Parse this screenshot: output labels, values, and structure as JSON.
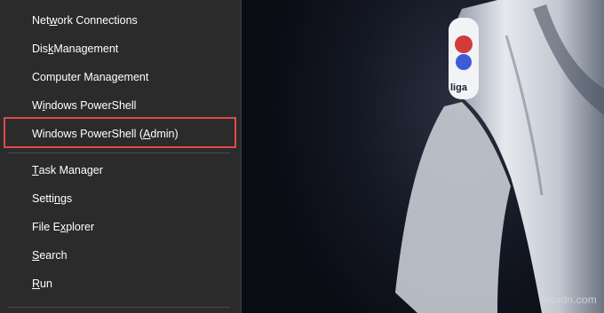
{
  "menu": {
    "items": [
      {
        "pre": "Net",
        "u": "w",
        "post": "ork Connections"
      },
      {
        "pre": "Dis",
        "u": "k",
        "post": " Management"
      },
      {
        "pre": "Computer Mana",
        "u": "g",
        "post": "ement"
      },
      {
        "pre": "W",
        "u": "i",
        "post": "ndows PowerShell"
      },
      {
        "pre": "Windows PowerShell (",
        "u": "A",
        "post": "dmin)"
      },
      {
        "pre": "",
        "u": "T",
        "post": "ask Manager"
      },
      {
        "pre": "Setti",
        "u": "n",
        "post": "gs"
      },
      {
        "pre": "File E",
        "u": "x",
        "post": "plorer"
      },
      {
        "pre": "",
        "u": "S",
        "post": "earch"
      },
      {
        "pre": "",
        "u": "R",
        "post": "un"
      }
    ],
    "highlighted_item": "Windows PowerShell (Admin)",
    "highlight_color": "#e24a4a"
  },
  "watermark": "wsxdn.com"
}
